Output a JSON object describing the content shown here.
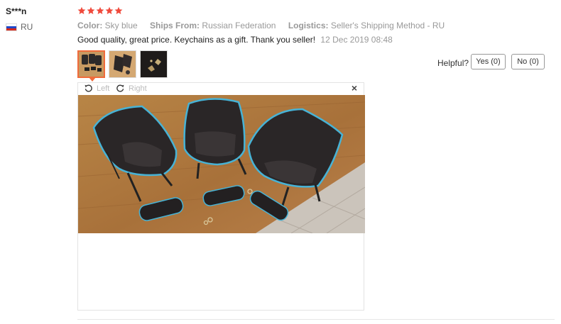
{
  "reviewer": {
    "name": "S***n",
    "country": "RU",
    "flag_icon": "russia-flag-icon"
  },
  "rating": {
    "stars": 5,
    "max": 5,
    "color": "#f04a3c"
  },
  "attributes": [
    {
      "key": "Color:",
      "value": "Sky blue"
    },
    {
      "key": "Ships From:",
      "value": "Russian Federation"
    },
    {
      "key": "Logistics:",
      "value": "Seller's Shipping Method - RU"
    }
  ],
  "review": {
    "text": "Good quality, great price. Keychains as a gift. Thank you seller!",
    "date": "12 Dec 2019 08:48"
  },
  "thumbnails": {
    "count": 3,
    "selected": 1,
    "active_color": "#f06b3b"
  },
  "helpful": {
    "label": "Helpful?",
    "yes_label": "Yes (0)",
    "no_label": "No (0)"
  },
  "viewer": {
    "rotate_left_label": "Left",
    "rotate_right_label": "Right",
    "close_glyph": "×",
    "icons": [
      "rotate-left-icon",
      "rotate-right-icon",
      "close-icon"
    ]
  }
}
